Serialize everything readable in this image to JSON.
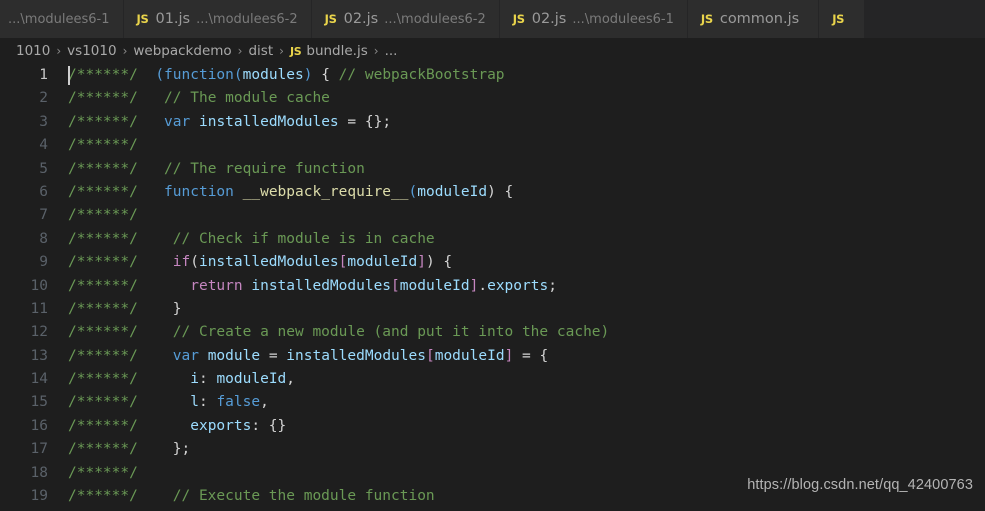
{
  "theme": {
    "editor_bg": "#1e1e1e",
    "tabbar_bg": "#252526",
    "tab_active_bg": "#2d2d2d",
    "comment": "#6a9955",
    "keyword": "#569cd6",
    "control": "#c586c0",
    "function": "#dcdcaa",
    "variable": "#9cdcfe",
    "plain": "#d4d4d4",
    "js_icon": "#e9d44b"
  },
  "tabs": [
    {
      "icon": "",
      "icon_name": "",
      "name": "",
      "path": "...\\modulees6-1",
      "active": false
    },
    {
      "icon": "JS",
      "icon_name": "js-file-icon",
      "name": "01.js",
      "path": "...\\modulees6-2",
      "active": false
    },
    {
      "icon": "JS",
      "icon_name": "js-file-icon",
      "name": "02.js",
      "path": "...\\modulees6-2",
      "active": false
    },
    {
      "icon": "JS",
      "icon_name": "js-file-icon",
      "name": "02.js",
      "path": "...\\modulees6-1",
      "active": false
    },
    {
      "icon": "JS",
      "icon_name": "js-file-icon",
      "name": "common.js",
      "path": "",
      "active": false
    }
  ],
  "tab_trailing": {
    "icon": "JS",
    "icon_name": "js-file-icon"
  },
  "breadcrumb": {
    "separator": "›",
    "items": [
      {
        "label": "1010",
        "icon": ""
      },
      {
        "label": "vs1010",
        "icon": ""
      },
      {
        "label": "webpackdemo",
        "icon": ""
      },
      {
        "label": "dist",
        "icon": ""
      },
      {
        "label": "bundle.js",
        "icon": "JS"
      },
      {
        "label": "...",
        "icon": ""
      }
    ]
  },
  "editor": {
    "active_line": 1,
    "cursor": {
      "line": 1,
      "column": 1
    },
    "prefix": "/******/",
    "lines": [
      {
        "num": "1",
        "indent": "",
        "tokens": [
          {
            "t": "(",
            "c": "paren"
          },
          {
            "t": "function",
            "c": "keyword"
          },
          {
            "t": "(",
            "c": "paren"
          },
          {
            "t": "modules",
            "c": "var"
          },
          {
            "t": ")",
            "c": "paren"
          },
          {
            "t": " { ",
            "c": "plain"
          },
          {
            "t": "// webpackBootstrap",
            "c": "comment"
          }
        ]
      },
      {
        "num": "2",
        "indent": " ",
        "tokens": [
          {
            "t": "// The module cache",
            "c": "comment"
          }
        ]
      },
      {
        "num": "3",
        "indent": " ",
        "tokens": [
          {
            "t": "var",
            "c": "keyword"
          },
          {
            "t": " ",
            "c": "plain"
          },
          {
            "t": "installedModules",
            "c": "var"
          },
          {
            "t": " = {};",
            "c": "plain"
          }
        ]
      },
      {
        "num": "4",
        "indent": "",
        "tokens": []
      },
      {
        "num": "5",
        "indent": " ",
        "tokens": [
          {
            "t": "// The require function",
            "c": "comment"
          }
        ]
      },
      {
        "num": "6",
        "indent": " ",
        "tokens": [
          {
            "t": "function",
            "c": "keyword"
          },
          {
            "t": " ",
            "c": "plain"
          },
          {
            "t": "__webpack_require__",
            "c": "fn"
          },
          {
            "t": "(",
            "c": "paren"
          },
          {
            "t": "moduleId",
            "c": "var"
          },
          {
            "t": ") {",
            "c": "plain"
          }
        ]
      },
      {
        "num": "7",
        "indent": "",
        "tokens": []
      },
      {
        "num": "8",
        "indent": "  ",
        "tokens": [
          {
            "t": "// Check if module is in cache",
            "c": "comment"
          }
        ]
      },
      {
        "num": "9",
        "indent": "  ",
        "tokens": [
          {
            "t": "if",
            "c": "control"
          },
          {
            "t": "(",
            "c": "plain"
          },
          {
            "t": "installedModules",
            "c": "var"
          },
          {
            "t": "[",
            "c": "bracket"
          },
          {
            "t": "moduleId",
            "c": "var"
          },
          {
            "t": "]",
            "c": "bracket"
          },
          {
            "t": ") {",
            "c": "plain"
          }
        ]
      },
      {
        "num": "10",
        "indent": "    ",
        "tokens": [
          {
            "t": "return",
            "c": "control"
          },
          {
            "t": " ",
            "c": "plain"
          },
          {
            "t": "installedModules",
            "c": "var"
          },
          {
            "t": "[",
            "c": "bracket"
          },
          {
            "t": "moduleId",
            "c": "var"
          },
          {
            "t": "]",
            "c": "bracket"
          },
          {
            "t": ".",
            "c": "plain"
          },
          {
            "t": "exports",
            "c": "var"
          },
          {
            "t": ";",
            "c": "plain"
          }
        ]
      },
      {
        "num": "11",
        "indent": "  ",
        "tokens": [
          {
            "t": "}",
            "c": "plain"
          }
        ]
      },
      {
        "num": "12",
        "indent": "  ",
        "tokens": [
          {
            "t": "// Create a new module (and put it into the cache)",
            "c": "comment"
          }
        ]
      },
      {
        "num": "13",
        "indent": "  ",
        "tokens": [
          {
            "t": "var",
            "c": "keyword"
          },
          {
            "t": " ",
            "c": "plain"
          },
          {
            "t": "module",
            "c": "var"
          },
          {
            "t": " = ",
            "c": "plain"
          },
          {
            "t": "installedModules",
            "c": "var"
          },
          {
            "t": "[",
            "c": "bracket"
          },
          {
            "t": "moduleId",
            "c": "var"
          },
          {
            "t": "]",
            "c": "bracket"
          },
          {
            "t": " = {",
            "c": "plain"
          }
        ]
      },
      {
        "num": "14",
        "indent": "    ",
        "tokens": [
          {
            "t": "i",
            "c": "var"
          },
          {
            "t": ": ",
            "c": "plain"
          },
          {
            "t": "moduleId",
            "c": "var"
          },
          {
            "t": ",",
            "c": "plain"
          }
        ]
      },
      {
        "num": "15",
        "indent": "    ",
        "tokens": [
          {
            "t": "l",
            "c": "var"
          },
          {
            "t": ": ",
            "c": "plain"
          },
          {
            "t": "false",
            "c": "keyword"
          },
          {
            "t": ",",
            "c": "plain"
          }
        ]
      },
      {
        "num": "16",
        "indent": "    ",
        "tokens": [
          {
            "t": "exports",
            "c": "var"
          },
          {
            "t": ": {}",
            "c": "plain"
          }
        ]
      },
      {
        "num": "17",
        "indent": "  ",
        "tokens": [
          {
            "t": "};",
            "c": "plain"
          }
        ]
      },
      {
        "num": "18",
        "indent": "",
        "tokens": []
      },
      {
        "num": "19",
        "indent": "  ",
        "tokens": [
          {
            "t": "// Execute the module function",
            "c": "comment"
          }
        ]
      }
    ]
  },
  "watermark": "https://blog.csdn.net/qq_42400763"
}
